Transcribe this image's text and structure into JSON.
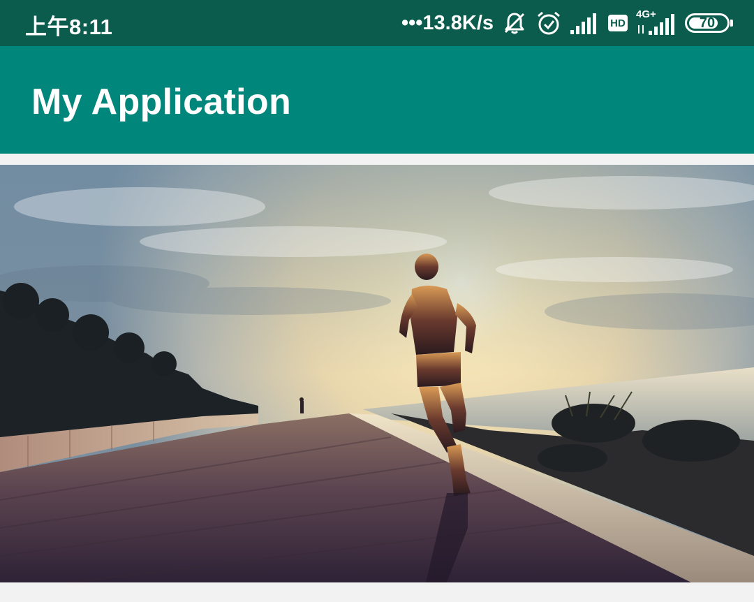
{
  "status_bar": {
    "time": "上午8:11",
    "net_speed": "•••13.8K/s",
    "icons": [
      "bell-off-icon",
      "alarm-icon",
      "signal-icon",
      "hd-badge",
      "4g-signal-icon",
      "battery-icon"
    ],
    "hd_label": "HD",
    "network_type": "4G+",
    "battery_level": "70",
    "background_color": "#0c5c4d"
  },
  "app_bar": {
    "title": "My Application",
    "background_color": "#00867a"
  },
  "content": {
    "image": "runner-at-sunset-photo"
  }
}
